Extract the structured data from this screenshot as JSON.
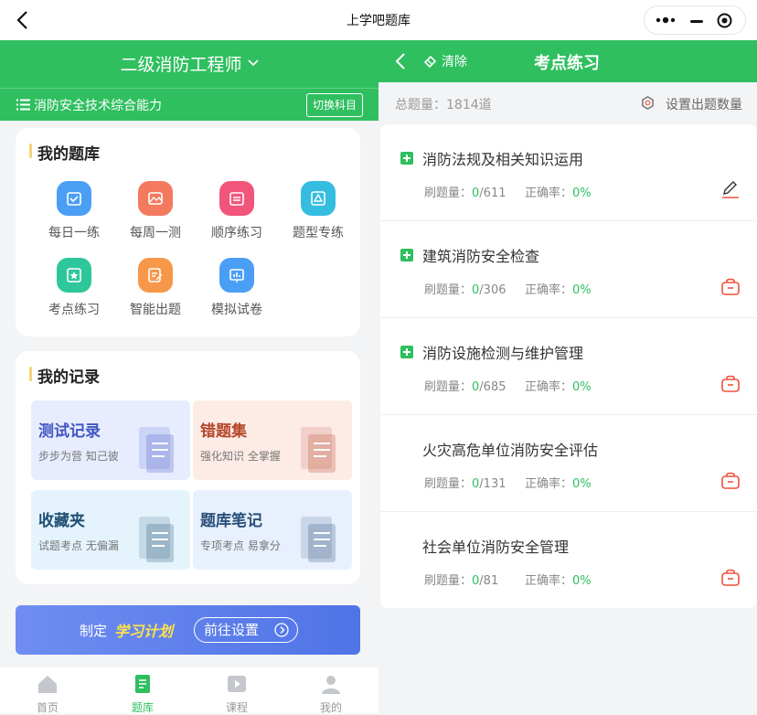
{
  "topbar": {
    "title": "上学吧题库"
  },
  "left": {
    "exam_name": "二级消防工程师",
    "subject": "消防安全技术综合能力",
    "switch_label": "切换科目",
    "my_bank": {
      "title": "我的题库",
      "tools": [
        {
          "label": "每日一练",
          "color": "#4a9ff5",
          "icon": "calendar-check-icon"
        },
        {
          "label": "每周一测",
          "color": "#f37a5f",
          "icon": "image-icon"
        },
        {
          "label": "顺序练习",
          "color": "#f2557a",
          "icon": "calendar-list-icon"
        },
        {
          "label": "题型专练",
          "color": "#35bde0",
          "icon": "triangle-doc-icon"
        },
        {
          "label": "考点练习",
          "color": "#2ec79b",
          "icon": "star-doc-icon"
        },
        {
          "label": "智能出题",
          "color": "#f7974a",
          "icon": "edit-doc-icon"
        },
        {
          "label": "模拟试卷",
          "color": "#4a9ff5",
          "icon": "chart-board-icon"
        }
      ]
    },
    "my_records": {
      "title": "我的记录",
      "cards": [
        {
          "title": "测试记录",
          "sub": "步步为营 知己彼",
          "bg": "#e8ecff",
          "color": "#4157c2"
        },
        {
          "title": "错题集",
          "sub": "强化知识 全掌握",
          "bg": "#fdebe6",
          "color": "#b4462a"
        },
        {
          "title": "收藏夹",
          "sub": "试题考点 无偏漏",
          "bg": "#e4f3fc",
          "color": "#1f4f73"
        },
        {
          "title": "题库笔记",
          "sub": "专项考点 易拿分",
          "bg": "#e7f0fc",
          "color": "#2a4f7a"
        }
      ]
    },
    "banner": {
      "prefix": "制定",
      "highlight": "学习计划",
      "button": "前往设置"
    },
    "tabs": [
      {
        "label": "首页",
        "icon": "home-icon",
        "active": false
      },
      {
        "label": "题库",
        "icon": "question-bank-icon",
        "active": true
      },
      {
        "label": "课程",
        "icon": "video-icon",
        "active": false
      },
      {
        "label": "我的",
        "icon": "user-icon",
        "active": false
      }
    ]
  },
  "right": {
    "title": "考点练习",
    "clear_label": "清除",
    "total": "总题量：1814道",
    "set_count": "设置出题数量",
    "items": [
      {
        "name": "消防法规及相关知识运用",
        "done": "0",
        "total": "/611",
        "acc": "0%",
        "expandable": true,
        "action": "edit-icon"
      },
      {
        "name": "建筑消防安全检查",
        "done": "0",
        "total": "/306",
        "acc": "0%",
        "expandable": true,
        "action": "locked-bag-icon"
      },
      {
        "name": "消防设施检测与维护管理",
        "done": "0",
        "total": "/685",
        "acc": "0%",
        "expandable": true,
        "action": "locked-bag-icon"
      },
      {
        "name": "火灾高危单位消防安全评估",
        "done": "0",
        "total": "/131",
        "acc": "0%",
        "expandable": false,
        "action": "locked-bag-icon"
      },
      {
        "name": "社会单位消防安全管理",
        "done": "0",
        "total": "/81",
        "acc": "0%",
        "expandable": false,
        "action": "locked-bag-icon"
      }
    ],
    "labels": {
      "brushed": "刷题量：",
      "accuracy": "正确率："
    }
  }
}
